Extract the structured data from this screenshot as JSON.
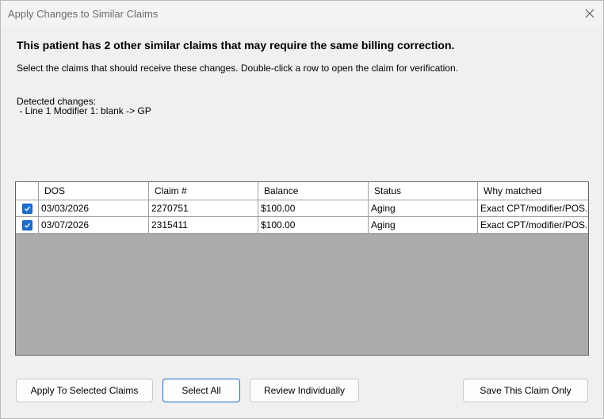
{
  "window": {
    "title": "Apply Changes to Similar Claims"
  },
  "main": {
    "heading": "This patient has 2 other similar claims that may require the same billing correction.",
    "instructions": "Select the claims that should receive these changes. Double-click a row to open the claim for verification.",
    "changes_label": "Detected changes:",
    "changes": [
      " - Line 1 Modifier 1: blank -> GP"
    ]
  },
  "grid": {
    "columns": [
      "",
      "DOS",
      "Claim #",
      "Balance",
      "Status",
      "Why matched"
    ],
    "rows": [
      {
        "checked": true,
        "dos": "03/03/2026",
        "claim": "2270751",
        "balance": "$100.00",
        "status": "Aging",
        "why": "Exact CPT/modifier/POS..."
      },
      {
        "checked": true,
        "dos": "03/07/2026",
        "claim": "2315411",
        "balance": "$100.00",
        "status": "Aging",
        "why": "Exact CPT/modifier/POS..."
      }
    ]
  },
  "buttons": {
    "apply_selected": "Apply To Selected Claims",
    "select_all": "Select All",
    "review_individually": "Review Individually",
    "save_this_only": "Save This Claim Only"
  },
  "icons": {
    "close": "close-icon",
    "check": "check-icon"
  },
  "colors": {
    "accent": "#1a6fd1",
    "grid_background": "#ababab"
  }
}
